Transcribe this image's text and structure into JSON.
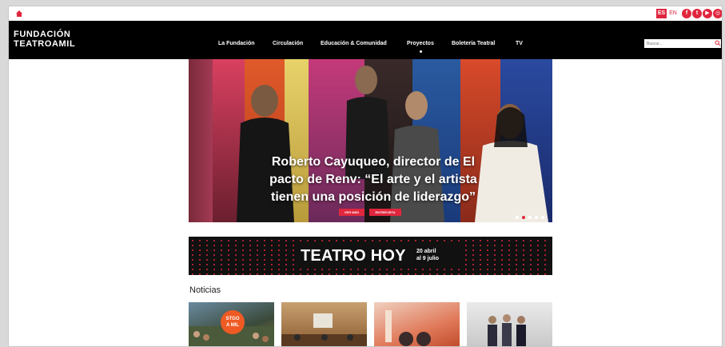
{
  "utility": {
    "lang_es": "ES",
    "lang_en": "EN",
    "social": [
      {
        "icon": "facebook-icon",
        "glyph": "f"
      },
      {
        "icon": "twitter-icon",
        "glyph": "t"
      },
      {
        "icon": "youtube-icon",
        "glyph": "▶"
      },
      {
        "icon": "instagram-icon",
        "glyph": "◎"
      }
    ]
  },
  "header": {
    "logo_line1": "FUNDACIÓN",
    "logo_line2": "TEATROAMIL",
    "search_placeholder": "Buscar..."
  },
  "nav": {
    "items": [
      {
        "label": "La Fundación"
      },
      {
        "label": "Circulación"
      },
      {
        "label": "Educación & Comunidad"
      },
      {
        "label": "Proyectos"
      },
      {
        "label": "Boletería Teatral"
      },
      {
        "label": "TV"
      }
    ],
    "active_index": 3
  },
  "hero": {
    "caption": "Roberto Cayuqueo, director de El pacto de Renv: “El arte y el artista tienen una posición de liderazgo”",
    "btn_primary": "VER MÁS",
    "btn_secondary": "ENTREVISTA",
    "slide_count": 5,
    "active_slide": 1
  },
  "banner": {
    "title": "TEATRO HOY",
    "dates_line1": "20 abril",
    "dates_line2": "al 9 julio"
  },
  "noticias": {
    "title": "Noticias",
    "first_badge_line1": "STGO",
    "first_badge_line2": "A MIL"
  },
  "colors": {
    "accent": "#e0263d",
    "header_bg": "#000000",
    "banner_bg": "#111111",
    "banner_dot": "#e0263d"
  }
}
